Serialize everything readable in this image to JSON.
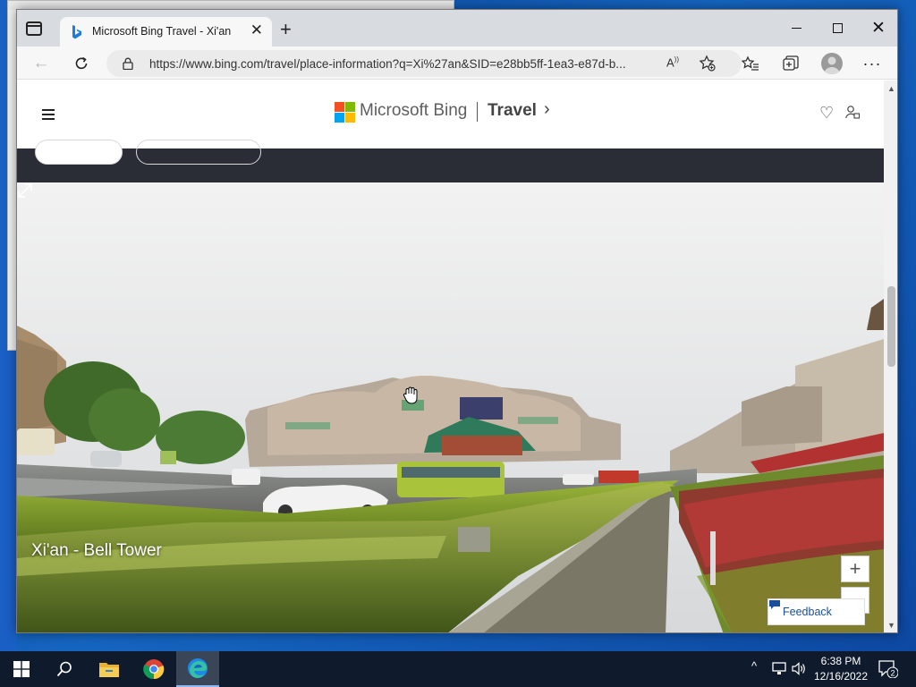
{
  "browser": {
    "tab_title": "Microsoft Bing Travel - Xi'an",
    "url": "https://www.bing.com/travel/place-information?q=Xi%27an&SID=e28bb5ff-1ea3-e87d-b..."
  },
  "header": {
    "brand": "Microsoft Bing",
    "section": "Travel"
  },
  "pano": {
    "caption": "Xi'an - Bell Tower",
    "zoom_in_label": "+",
    "zoom_out_label": "—",
    "feedback_label": "Feedback"
  },
  "taskbar": {
    "time": "6:38 PM",
    "date": "12/16/2022",
    "notification_count": "2"
  },
  "colors": {
    "accent": "#1a4f9c",
    "dark_band": "#2a2c36",
    "taskbar": "#0f1b2d"
  }
}
